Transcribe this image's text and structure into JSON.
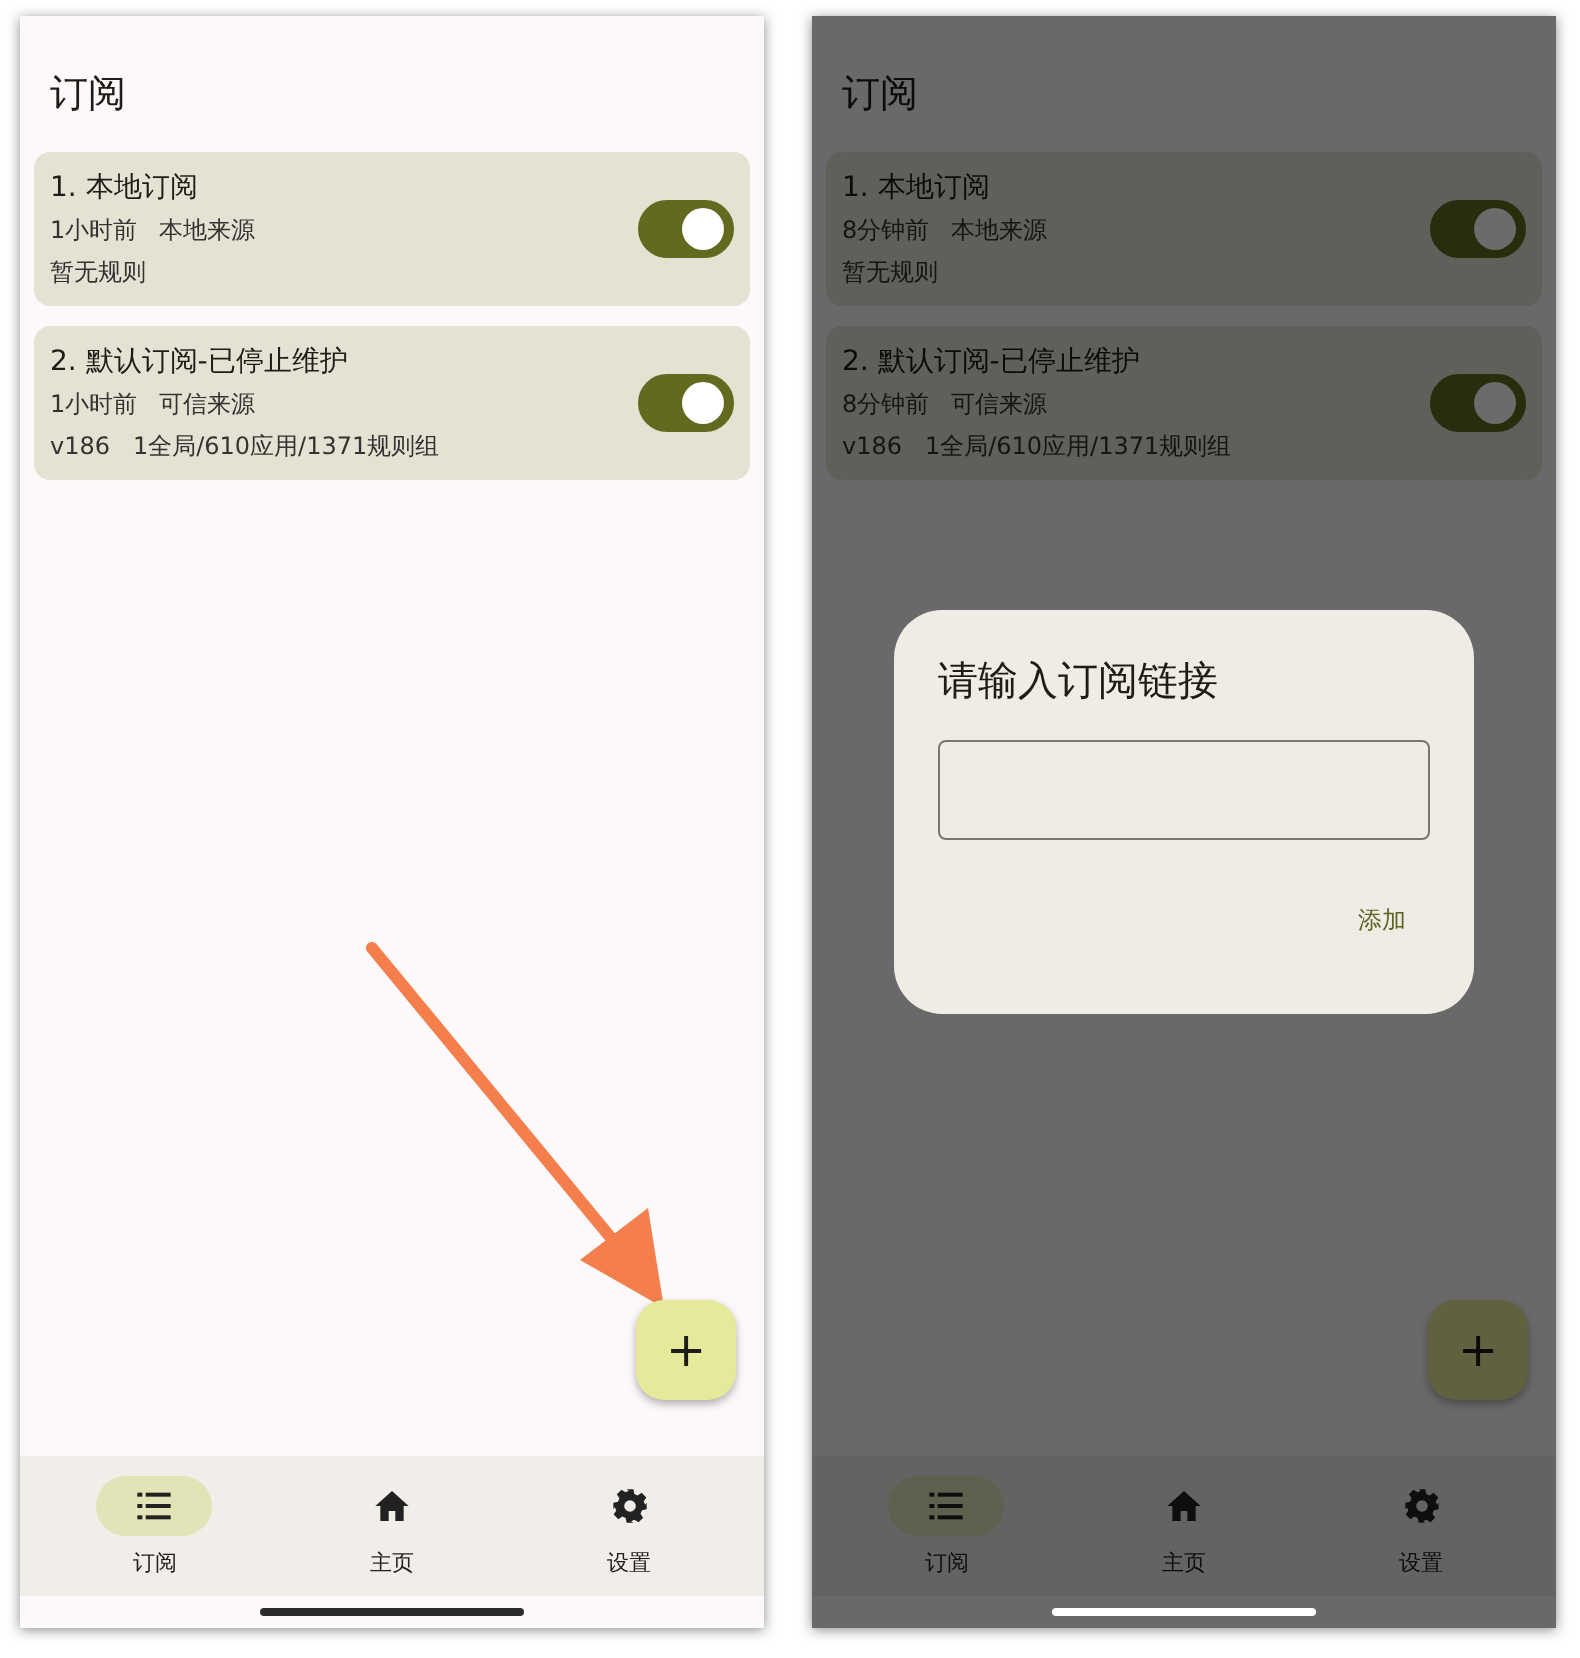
{
  "panels": [
    {
      "title": "订阅",
      "subscriptions": [
        {
          "name": "1. 本地订阅",
          "time": "1小时前",
          "source": "本地来源",
          "rules": "暂无规则",
          "enabled": true
        },
        {
          "name": "2. 默认订阅-已停止维护",
          "time": "1小时前",
          "source": "可信来源",
          "rules": "v186   1全局/610应用/1371规则组",
          "enabled": true
        }
      ],
      "fab": "+",
      "annotation": {
        "kind": "arrow"
      },
      "nav": [
        {
          "kind": "list",
          "label": "订阅",
          "selected": true
        },
        {
          "kind": "home",
          "label": "主页",
          "selected": false
        },
        {
          "kind": "gear",
          "label": "设置",
          "selected": false
        }
      ]
    },
    {
      "title": "订阅",
      "subscriptions": [
        {
          "name": "1. 本地订阅",
          "time": "8分钟前",
          "source": "本地来源",
          "rules": "暂无规则",
          "enabled": true
        },
        {
          "name": "2. 默认订阅-已停止维护",
          "time": "8分钟前",
          "source": "可信来源",
          "rules": "v186   1全局/610应用/1371规则组",
          "enabled": true
        }
      ],
      "fab": "+",
      "nav": [
        {
          "kind": "list",
          "label": "订阅",
          "selected": true
        },
        {
          "kind": "home",
          "label": "主页",
          "selected": false
        },
        {
          "kind": "gear",
          "label": "设置",
          "selected": false
        }
      ],
      "dialog": {
        "title": "请输入订阅链接",
        "button": "添加"
      }
    }
  ]
}
